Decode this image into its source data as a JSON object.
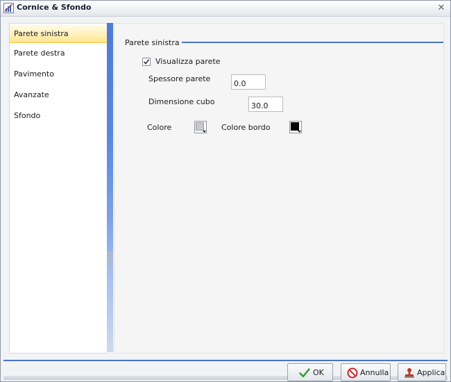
{
  "window": {
    "title": "Cornice & Sfondo",
    "close_glyph": "✕"
  },
  "sidebar": {
    "items": [
      {
        "label": "Parete sinistra",
        "selected": true
      },
      {
        "label": "Parete destra",
        "selected": false
      },
      {
        "label": "Pavimento",
        "selected": false
      },
      {
        "label": "Avanzate",
        "selected": false
      },
      {
        "label": "Sfondo",
        "selected": false
      }
    ]
  },
  "panel": {
    "section_title": "Parete sinistra",
    "show_wall_label": "Visualizza parete",
    "show_wall_checked": true,
    "thickness_label": "Spessore parete",
    "thickness_value": "0.0",
    "cube_size_label": "Dimensione cubo",
    "cube_size_value": "30.0",
    "color_label": "Colore",
    "color_value": "#c8c8c8",
    "border_color_label": "Colore bordo",
    "border_color_value": "#000000"
  },
  "footer": {
    "ok_label": "OK",
    "cancel_label": "Annulla",
    "apply_label": "Applica"
  },
  "colors": {
    "accent": "#4a74c4",
    "selected_item": "#ffe48a"
  },
  "icons": {
    "app": "chart-window-icon",
    "close": "close-icon",
    "ok": "check-icon",
    "cancel": "no-entry-icon",
    "apply": "stamp-icon"
  }
}
